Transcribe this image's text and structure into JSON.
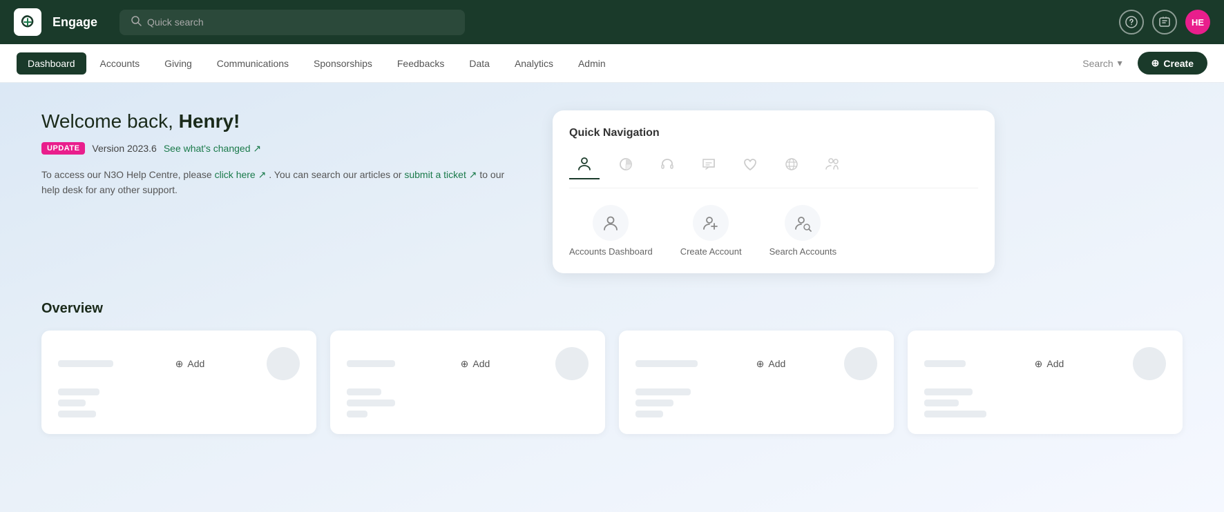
{
  "app": {
    "name": "Engage",
    "avatar_initials": "HE",
    "avatar_bg": "#e91e8c"
  },
  "topbar": {
    "search_placeholder": "Quick search",
    "help_icon": "?",
    "check_icon": "✓"
  },
  "navbar": {
    "items": [
      {
        "label": "Dashboard",
        "active": true
      },
      {
        "label": "Accounts",
        "active": false
      },
      {
        "label": "Giving",
        "active": false
      },
      {
        "label": "Communications",
        "active": false
      },
      {
        "label": "Sponsorships",
        "active": false
      },
      {
        "label": "Feedbacks",
        "active": false
      },
      {
        "label": "Data",
        "active": false
      },
      {
        "label": "Analytics",
        "active": false
      },
      {
        "label": "Admin",
        "active": false
      }
    ],
    "search_label": "Search",
    "create_label": "+ Create"
  },
  "welcome": {
    "greeting": "Welcome back,",
    "name": "Henry!",
    "badge": "UPDATE",
    "version": "Version 2023.6",
    "changelog_link": "See what's changed",
    "help_text_1": "To access our N3O Help Centre, please",
    "help_link_1": "click here",
    "help_text_2": ". You can search our articles or",
    "help_link_2": "submit a ticket",
    "help_text_3": "to our help desk for any other support."
  },
  "quick_nav": {
    "title": "Quick Navigation",
    "tabs": [
      {
        "icon": "person",
        "active": true
      },
      {
        "icon": "chart-pie",
        "active": false
      },
      {
        "icon": "headset",
        "active": false
      },
      {
        "icon": "chat-bubble",
        "active": false
      },
      {
        "icon": "heart",
        "active": false
      },
      {
        "icon": "globe",
        "active": false
      },
      {
        "icon": "people",
        "active": false
      }
    ],
    "actions": [
      {
        "label": "Accounts Dashboard",
        "icon": "person"
      },
      {
        "label": "Create Account",
        "icon": "person-add"
      },
      {
        "label": "Search Accounts",
        "icon": "person-search"
      }
    ]
  },
  "overview": {
    "title": "Overview",
    "cards": [
      {
        "add_label": "Add"
      },
      {
        "add_label": "Add"
      },
      {
        "add_label": "Add"
      },
      {
        "add_label": "Add"
      }
    ]
  }
}
